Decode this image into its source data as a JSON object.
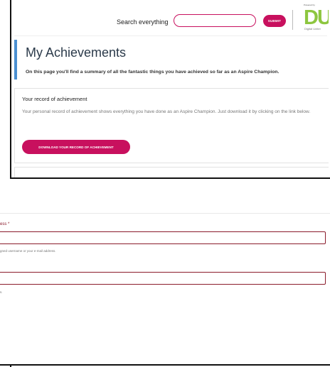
{
  "header": {
    "search_label": "Search everything",
    "search_value": "",
    "submit_label": "SUBMIT",
    "logo": {
      "top_text": "Powered by",
      "mark": "DU",
      "sub_text": "Digital Uniter"
    }
  },
  "page": {
    "title": "My Achievements",
    "intro": "On this page you'll find a summary of all the fantastic things you have achieved so far as an Aspire Champion."
  },
  "record_card": {
    "title": "Your record of achievement",
    "description": "Your personal record of achievement shows everything you have done as an Aspire Champion. Just download it by clicking on the link below.",
    "download_label": "DOWNLOAD YOUR RECORD OF ACHIEVEMENT"
  },
  "login_form": {
    "username_label": "ess *",
    "username_value": "",
    "username_help": "gned username or your e-mail address.",
    "password_value": "",
    "password_help": "s."
  },
  "colors": {
    "accent": "#c8105e",
    "title_bar": "#4a8fd1",
    "logo_green": "#8dc63f",
    "field_border": "#8b1c2c"
  }
}
